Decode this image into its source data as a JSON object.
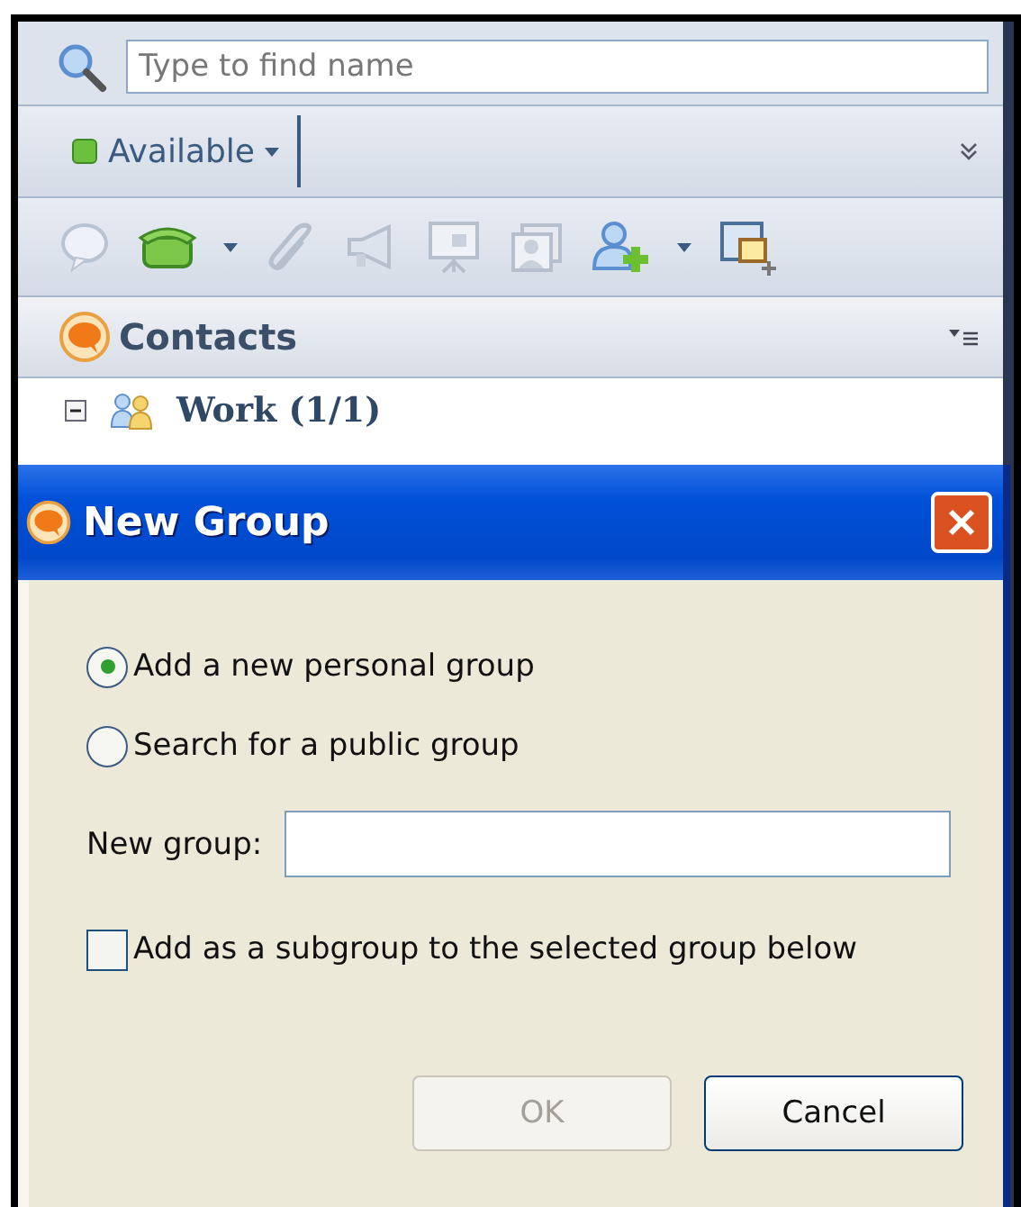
{
  "search": {
    "placeholder": "Type to find name"
  },
  "status": {
    "label": "Available",
    "color": "#6cc040"
  },
  "contacts": {
    "title": "Contacts",
    "groups": [
      {
        "label": "Work (1/1)",
        "expanded": true
      }
    ]
  },
  "dialog": {
    "title": "New Group",
    "options": [
      {
        "label": "Add a new personal group",
        "selected": true
      },
      {
        "label": "Search for a public group",
        "selected": false
      }
    ],
    "field": {
      "label": "New group:"
    },
    "checkbox": {
      "label": "Add as a subgroup to the selected group below",
      "checked": false
    },
    "buttons": [
      {
        "label": "OK",
        "disabled": true
      },
      {
        "label": "Cancel",
        "disabled": false
      }
    ]
  }
}
